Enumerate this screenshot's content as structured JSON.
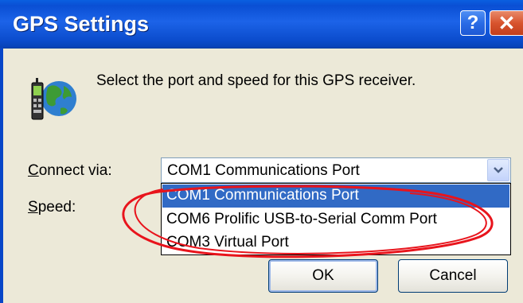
{
  "window": {
    "title": "GPS Settings",
    "help_label": "?",
    "close_label": "✕"
  },
  "description": "Select the port and speed for this GPS receiver.",
  "connect_via": {
    "label_accel": "C",
    "label_rest": "onnect via:",
    "selected_value": "COM1 Communications Port"
  },
  "speed": {
    "label_accel": "S",
    "label_rest": "peed:"
  },
  "dropdown": {
    "items": [
      {
        "label": "COM1 Communications Port",
        "selected": true
      },
      {
        "label": "COM6 Prolific USB-to-Serial Comm Port",
        "selected": false
      },
      {
        "label": "COM3 Virtual Port",
        "selected": false
      }
    ]
  },
  "buttons": {
    "ok": "OK",
    "cancel": "Cancel"
  },
  "colors": {
    "titlebar": "#0a4fd4",
    "selection": "#316ac5",
    "annotation": "#e8141c",
    "dialog_bg": "#ece9d8"
  },
  "icons": {
    "app_icon": "gps-receiver-globe-icon",
    "help": "help-icon",
    "close": "close-icon",
    "dropdown": "chevron-down-icon"
  }
}
